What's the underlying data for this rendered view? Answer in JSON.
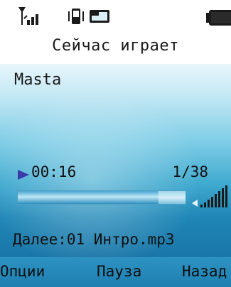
{
  "status_bar": {
    "icons": [
      "signal-icon",
      "vibrate-icon",
      "message-icon",
      "battery-icon"
    ]
  },
  "header": {
    "title": "Сейчас играет"
  },
  "now_playing": {
    "artist": "Masta",
    "elapsed": "00:16",
    "track_position": "1/38",
    "progress_fraction": 0.84,
    "next_label": "Далее:01 Интро.mp3"
  },
  "softkeys": {
    "left": "Опции",
    "middle": "Пауза",
    "right": "Назад"
  },
  "colors": {
    "accent": "#1f86b6",
    "text": "#101010"
  }
}
